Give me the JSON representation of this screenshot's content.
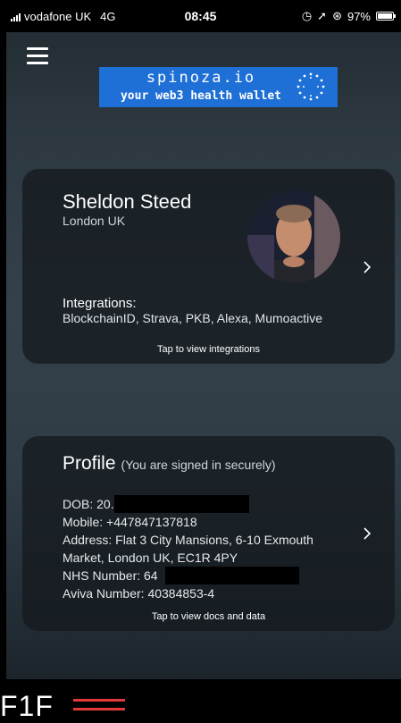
{
  "status_bar": {
    "carrier": "vodafone UK",
    "network": "4G",
    "time": "08:45",
    "battery": "97%",
    "battery_level": 0.97
  },
  "banner": {
    "line1": "spinoza.io",
    "line2": "your web3 health wallet",
    "color": "#1e6fd6"
  },
  "user_card": {
    "name": "Sheldon Steed",
    "location": "London UK",
    "integrations_title": "Integrations:",
    "integrations_list": "BlockchainID, Strava, PKB, Alexa, Mumoactive",
    "tap_text": "Tap to view integrations"
  },
  "profile_card": {
    "title": "Profile",
    "subtitle": "(You are signed in securely)",
    "dob": "DOB: 20.",
    "mobile": "Mobile: +447847137818",
    "address_line1": "Address: Flat 3 City Mansions, 6-10 Exmouth",
    "address_line2": "Market, London UK, EC1R 4PY",
    "nhs": "NHS Number: 64",
    "aviva": "Aviva Number: 40384853-4",
    "tap_text": "Tap to view docs and data"
  },
  "footer": {
    "logo_text": "F1F",
    "accent_color": "#e23a3a"
  }
}
